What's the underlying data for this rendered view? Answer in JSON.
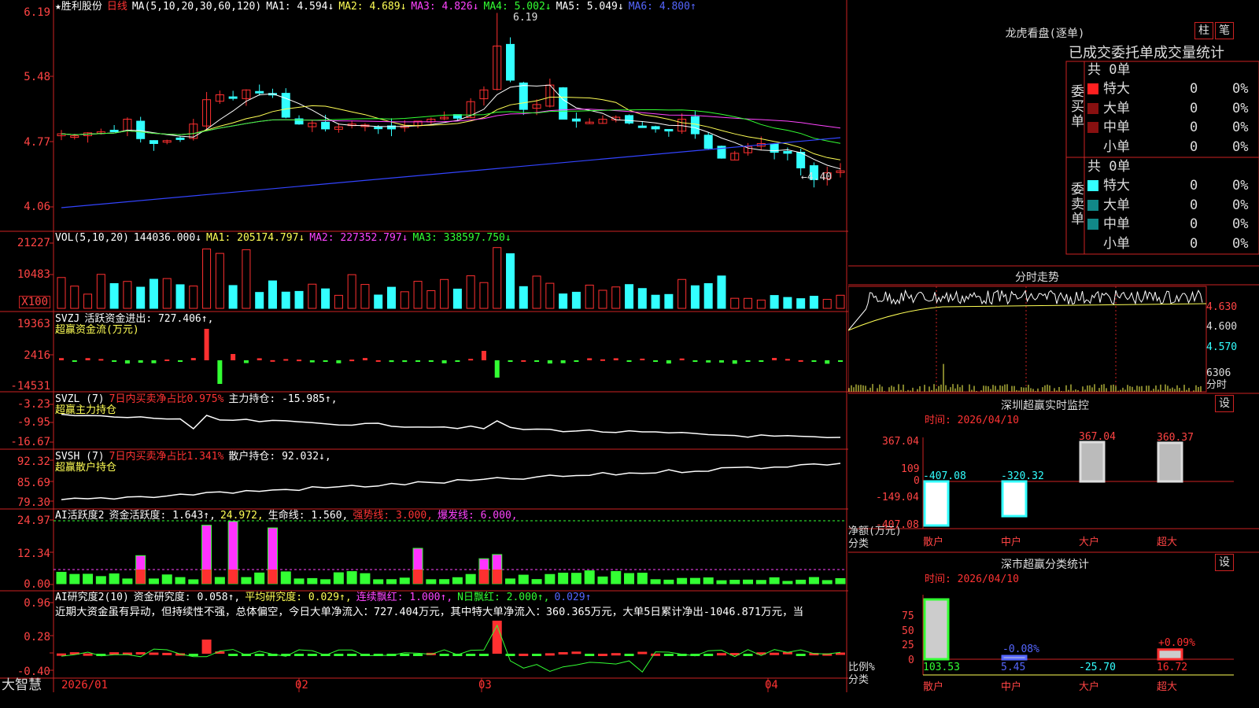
{
  "header": {
    "stock": "★胜利股份",
    "period": "日线",
    "ma_label": "MA(5,10,20,30,60,120)",
    "ma1": "MA1: 4.594↓",
    "ma2": "MA2: 4.689↓",
    "ma3": "MA3: 4.826↓",
    "ma4": "MA4: 5.002↓",
    "ma5": "MA5: 5.049↓",
    "ma6": "MA6: 4.800↑"
  },
  "price_panel": {
    "y_labels": [
      "6.19",
      "5.48",
      "4.77",
      "4.06"
    ],
    "high_marker": "6.19",
    "low_marker": "←4.40"
  },
  "vol_panel": {
    "header": "VOL(5,10,20)",
    "value": "144036.000↓",
    "ma1": "MA1: 205174.797↓",
    "ma2": "MA2: 227352.797↓",
    "ma3": "MA3: 338597.750↓",
    "y_labels": [
      "21227",
      "10483"
    ],
    "unit": "X100"
  },
  "svzj_panel": {
    "header": "SVZJ",
    "label": "活跃资金进出: 727.406↑,",
    "subtitle": "超赢资金流(万元)",
    "y_labels": [
      "19363",
      "2416",
      "-14531"
    ]
  },
  "svzl_panel": {
    "header": "SVZL (7)",
    "label": "7日内买卖净占比0.975%",
    "label2": "主力持仓: -15.985↑,",
    "subtitle": "超赢主力持仓",
    "y_labels": [
      "-3.23",
      "-9.95",
      "-16.67"
    ]
  },
  "svsh_panel": {
    "header": "SVSH (7)",
    "label": "7日内买卖净占比1.341%",
    "label2": "散户持仓: 92.032↓,",
    "subtitle": "超赢散户持仓",
    "y_labels": [
      "92.32",
      "85.69",
      "79.30"
    ]
  },
  "ai_active_panel": {
    "header": "AI活跃度2",
    "label": "资金活跃度: 1.643↑,",
    "v2": "24.972,",
    "v3": "生命线: 1.560,",
    "v4": "强势线: 3.000,",
    "v5": "爆发线: 6.000,",
    "y_labels": [
      "24.97",
      "12.34",
      "0.00"
    ]
  },
  "ai_research_panel": {
    "header": "AI研究度2(10)",
    "label": "资金研究度: 0.058↑,",
    "v2": "平均研究度: 0.029↑,",
    "v3": "连续飘红: 1.000↑,",
    "v4": "N日飘红: 2.000↑,",
    "v5": "0.029↑",
    "comment": "近期大资金虽有异动，但持续性不强，总体偏空，今日大单净流入：727.404万元，其中特大单净流入：360.365万元，大单5日累计净出-1046.871万元，当",
    "y_labels": [
      "0.96",
      "0.28",
      "-0.40"
    ]
  },
  "x_axis": {
    "brand": "大智慧",
    "labels": [
      "2026/01",
      "02",
      "03",
      "04"
    ]
  },
  "right_panel": {
    "dragon_title": "龙虎看盘(逐单)",
    "btn_bar": "柱",
    "btn_pen": "笔",
    "stats_title": "已成交委托单成交量统计",
    "buy_side": "委买单",
    "sell_side": "委卖单",
    "buy_total": "共 0单",
    "sell_total": "共 0单",
    "buy_rows": [
      {
        "name": "特大",
        "count": "0",
        "pct": "0%"
      },
      {
        "name": "大单",
        "count": "0",
        "pct": "0%"
      },
      {
        "name": "中单",
        "count": "0",
        "pct": "0%"
      },
      {
        "name": "小单",
        "count": "0",
        "pct": "0%"
      }
    ],
    "sell_rows": [
      {
        "name": "特大",
        "count": "0",
        "pct": "0%"
      },
      {
        "name": "大单",
        "count": "0",
        "pct": "0%"
      },
      {
        "name": "中单",
        "count": "0",
        "pct": "0%"
      },
      {
        "name": "小单",
        "count": "0",
        "pct": "0%"
      }
    ],
    "intraday_title": "分时走势",
    "intraday_labels": [
      "4.630",
      "4.600",
      "4.570"
    ],
    "intraday_vol": "6306",
    "intraday_unit": "分时",
    "sz_title": "深圳超赢实时监控",
    "sz_btn": "设",
    "sz_time": "时间: 2026/04/10",
    "sz_y_labels": [
      "367.04",
      "109",
      "0",
      "-149.04",
      "-407.08"
    ],
    "sz_bars": [
      {
        "cat": "散户",
        "value": -407.08,
        "label": "-407.08"
      },
      {
        "cat": "中户",
        "value": -320.32,
        "label": "-320.32"
      },
      {
        "cat": "大户",
        "value": 367.04,
        "label": "367.04"
      },
      {
        "cat": "超大",
        "value": 360.37,
        "label": "360.37"
      }
    ],
    "sz_ylabel": "净额(万元)",
    "sz_xlabel": "分类",
    "cls_title": "深市超赢分类统计",
    "cls_btn": "设",
    "cls_time": "时间: 2026/04/10",
    "cls_y_labels": [
      "75",
      "50",
      "25",
      "0"
    ],
    "cls_bars": [
      {
        "cat": "散户",
        "value": 103.53,
        "label": "103.53",
        "top": ""
      },
      {
        "cat": "中户",
        "value": 5.45,
        "label": "5.45",
        "top": "-0.08%"
      },
      {
        "cat": "大户",
        "value": -25.7,
        "label": "-25.70",
        "top": ""
      },
      {
        "cat": "超大",
        "value": 16.72,
        "label": "16.72",
        "top": "+0.09%"
      }
    ],
    "cls_ylabel": "比例%",
    "cls_xlabel": "分类"
  },
  "colors": {
    "up": "#ff3030",
    "down": "#33ffff",
    "grid": "#cc2222",
    "ma1": "#ffffff",
    "ma2": "#ffff55",
    "ma3": "#ff44ff",
    "ma4": "#33ff33",
    "ma6": "#3344ff"
  }
}
